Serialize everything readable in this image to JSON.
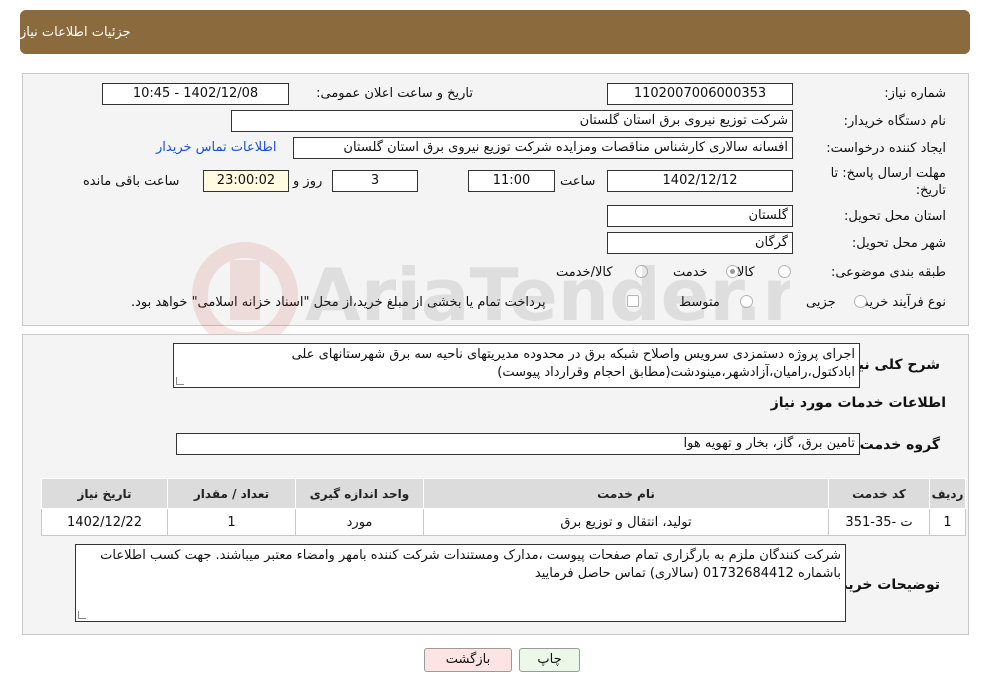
{
  "header": {
    "title": "جزئیات اطلاعات نیاز"
  },
  "form": {
    "need_number": {
      "label": "شماره نیاز:",
      "value": "1102007006000353"
    },
    "announce_datetime": {
      "label": "تاریخ و ساعت اعلان عمومی:",
      "value": "1402/12/08 - 10:45"
    },
    "buyer_org": {
      "label": "نام دستگاه خریدار:",
      "value": "شرکت توزیع نیروی برق استان گلستان"
    },
    "requester": {
      "label": "ایجاد کننده درخواست:",
      "value": "افسانه سالاری کارشناس مناقصات ومزایده شرکت توزیع نیروی برق استان گلستان"
    },
    "buyer_contact_link": "اطلاعات تماس خریدار",
    "deadline": {
      "label_line1": "مهلت ارسال پاسخ: تا",
      "label_line2": "تاریخ:",
      "date": "1402/12/12",
      "time_label": "ساعت",
      "time": "11:00",
      "days": "3",
      "days_label": "روز و",
      "remaining": "23:00:02",
      "remaining_label": "ساعت باقی مانده"
    },
    "province": {
      "label": "استان محل تحویل:",
      "value": "گلستان"
    },
    "city": {
      "label": "شهر محل تحویل:",
      "value": "گرگان"
    },
    "category": {
      "label": "طبقه بندی موضوعی:",
      "options": [
        {
          "label": "کالا",
          "selected": false
        },
        {
          "label": "خدمت",
          "selected": true
        },
        {
          "label": "کالا/خدمت",
          "selected": false
        }
      ]
    },
    "purchase_type": {
      "label": "نوع فرآیند خرید :",
      "options": [
        {
          "label": "جزیی",
          "selected": false
        },
        {
          "label": "متوسط",
          "selected": false
        },
        {
          "label": "پرداخت تمام یا بخشی از مبلغ خرید،از محل \"اسناد خزانه اسلامی\" خواهد بود.",
          "selected": false
        }
      ]
    }
  },
  "details": {
    "description_label": "شرح کلی نیاز:",
    "description": "اجرای پروژه دستمزدی سرویس واصلاح شبکه برق در محدوده  مدیریتهای ناحیه سه برق شهرستانهای علی ابادکتول،رامیان،آزادشهر،مینودشت(مطابق احجام وقرارداد پیوست)",
    "services_title": "اطلاعات خدمات مورد نیاز",
    "service_group_label": "گروه خدمت:",
    "service_group": "تامین برق، گاز، بخار و تهویه هوا",
    "table": {
      "headers": [
        "ردیف",
        "کد خدمت",
        "نام خدمت",
        "واحد اندازه گیری",
        "تعداد / مقدار",
        "تاریخ نیاز"
      ],
      "rows": [
        [
          "1",
          "ت -35-351",
          "تولید، انتقال و توزیع برق",
          "مورد",
          "1",
          "1402/12/22"
        ]
      ]
    },
    "buyer_notes_label": "توضیحات خریدار:",
    "buyer_notes": "شرکت کنندگان ملزم به بارگزاری تمام صفحات پیوست ،مدارک ومستندات شرکت کننده بامهر وامضاء معتبر میباشند. جهت کسب اطلاعات باشماره 01732684412 (سالاری) تماس حاصل فرمایید"
  },
  "buttons": {
    "print": "چاپ",
    "back": "بازگشت"
  },
  "watermark": "AriaTender.net"
}
